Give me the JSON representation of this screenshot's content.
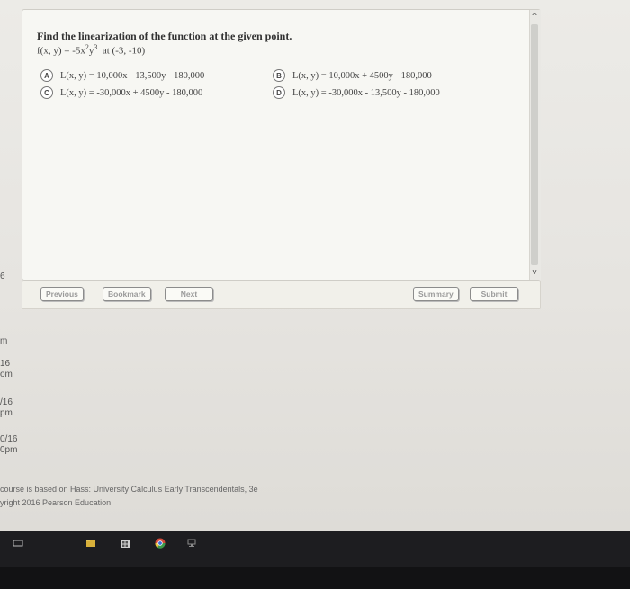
{
  "question": {
    "title": "Find the linearization of the function at the given point.",
    "function_prefix": "f(x, y) = -5x",
    "exp1": "2",
    "function_mid": "y",
    "exp2": "3",
    "point": "at  (-3, -10)"
  },
  "choices": [
    {
      "letter": "A",
      "text": "L(x, y) = 10,000x - 13,500y - 180,000"
    },
    {
      "letter": "B",
      "text": "L(x, y) = 10,000x + 4500y - 180,000"
    },
    {
      "letter": "C",
      "text": "L(x, y) = -30,000x + 4500y - 180,000"
    },
    {
      "letter": "D",
      "text": "L(x, y) = -30,000x - 13,500y - 180,000"
    }
  ],
  "scroll": {
    "up": "^",
    "down": "v"
  },
  "nav": {
    "previous": "Previous",
    "bookmark": "Bookmark",
    "next": "Next",
    "summary": "Summary",
    "submit": "Submit"
  },
  "left_strip": [
    "6",
    "m",
    "16",
    "om",
    "/16",
    "pm",
    "0/16",
    "0pm"
  ],
  "footer": {
    "line1": "course is based on Hass: University Calculus Early Transcendentals, 3e",
    "line2": "yright 2016 Pearson Education"
  },
  "taskbar_icons": [
    "task-view-icon",
    "file-explorer-icon",
    "store-icon",
    "chrome-icon",
    "network-icon"
  ]
}
